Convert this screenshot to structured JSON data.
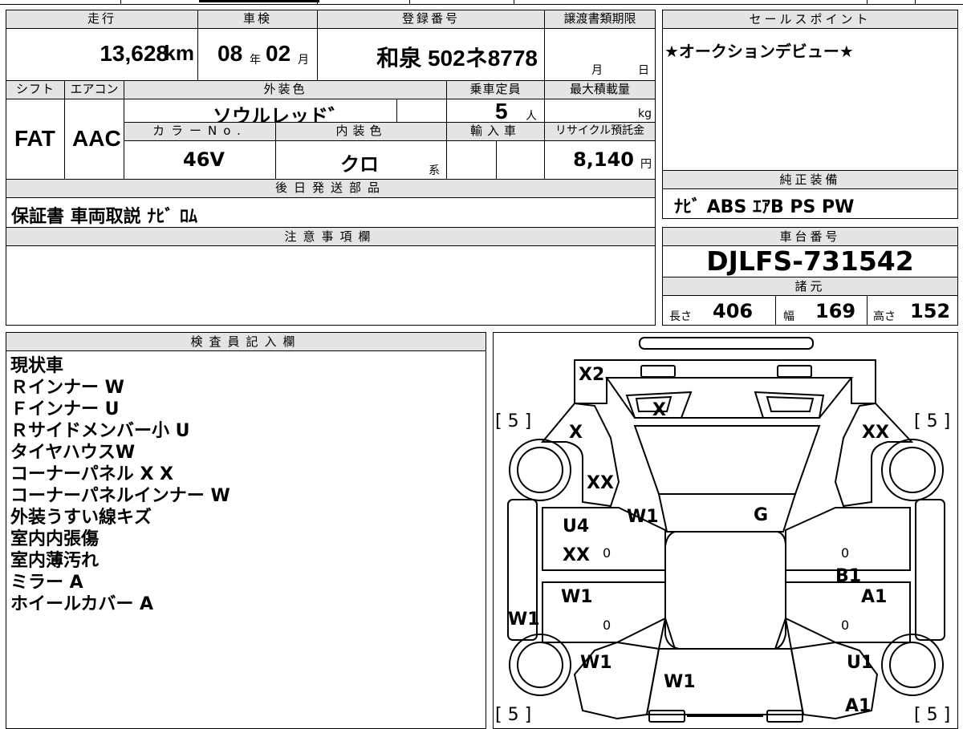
{
  "top": {
    "h_mileage": "走行",
    "mileage": "13,628",
    "mileage_unit": "km",
    "h_inspection": "車検",
    "insp_year": "08",
    "insp_year_unit": "年",
    "insp_month": "02",
    "insp_month_unit": "月",
    "h_registration": "登録番号",
    "registration": "和泉 502ネ8778",
    "h_transfer": "譲渡書類期限",
    "transfer_month": "月",
    "transfer_day": "日",
    "h_shift": "シフト",
    "shift": "FAT",
    "h_aircon": "エアコン",
    "aircon": "AAC",
    "h_exterior": "外装色",
    "exterior": "ソウルレッド゛",
    "h_capacity": "乗車定員",
    "capacity": "5",
    "capacity_unit": "人",
    "h_load": "最大積載量",
    "load_unit": "kg",
    "h_colorno": "カラーNo.",
    "colorno": "46V",
    "h_interior": "内装色",
    "interior": "クロ",
    "interior_unit": "系",
    "h_import": "輸入車",
    "h_recycle": "リサイクル預託金",
    "recycle": "8,140",
    "recycle_unit": "円",
    "h_parts": "後日発送部品",
    "parts": "保証書 車両取説 ﾅﾋﾞ ﾛﾑ"
  },
  "sales": {
    "header": "セールスポイント",
    "text": "★オークションデビュー★"
  },
  "equipment": {
    "header": "純正装備",
    "text": "ﾅﾋﾞ ABS ｴｱB PS PW"
  },
  "notes": {
    "header": "注意事項欄",
    "text": ""
  },
  "chassis": {
    "header": "車台番号",
    "number": "DJLFS-731542"
  },
  "specs": {
    "header": "諸元",
    "length_label": "長さ",
    "length": "406",
    "width_label": "幅",
    "width": "169",
    "height_label": "高さ",
    "height": "152"
  },
  "inspector": {
    "header": "検査員記入欄",
    "lines": [
      "現状車",
      "Ｒインナー W",
      "Ｆインナー U",
      "Ｒサイドメンバー小 U",
      "タイヤハウスW",
      "コーナーパネル X X",
      "コーナーパネルインナー W",
      "外装うすい線キズ",
      "室内内張傷",
      "室内薄汚れ",
      "ミラー A",
      "ホイールカバー A"
    ]
  },
  "diagram": {
    "tire_marks": [
      "[ 5 ]",
      "[ 5 ]",
      "[ 5 ]",
      "[ 5 ]"
    ],
    "marks": {
      "front_bumper": "X2",
      "grille": "X",
      "left_fender_top": "X",
      "right_fender_top": "XX",
      "left_fender": "XX",
      "windshield_left": "W1",
      "windshield_right": "G",
      "left_front_door_1": "U4",
      "left_front_door_2": "XX",
      "left_rear_door": "W1",
      "left_rocker": "W1",
      "right_pillar": "B1",
      "right_rear_door": "A1",
      "left_rear_fender": "W1",
      "rear_window": "W1",
      "right_rear_fender": "U1",
      "rear_right": "A1"
    },
    "zeros": [
      "0",
      "0",
      "0",
      "0"
    ]
  }
}
